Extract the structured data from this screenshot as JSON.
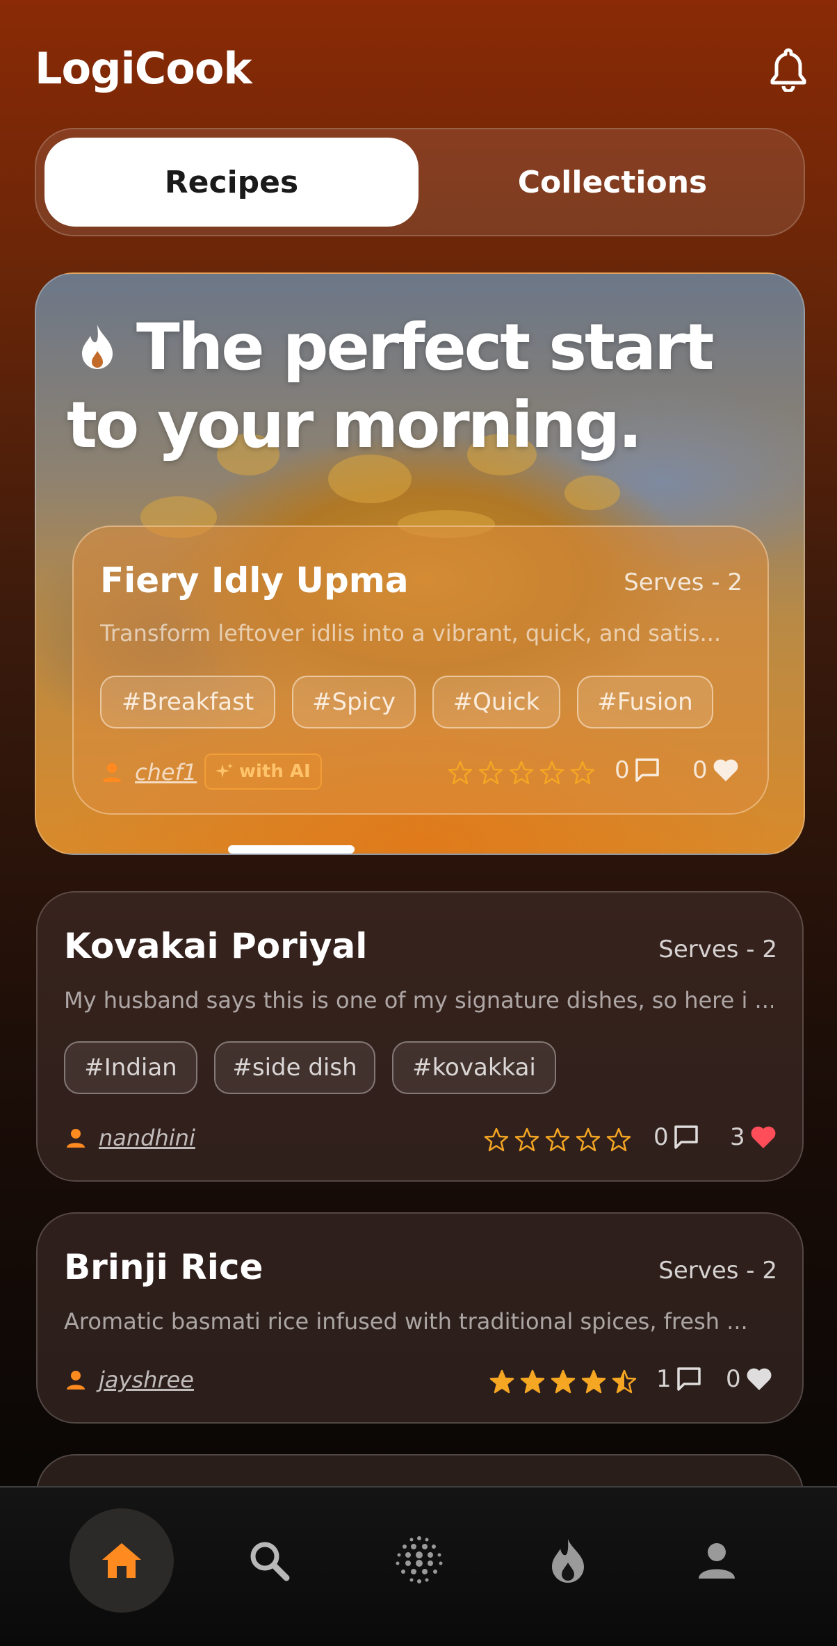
{
  "header": {
    "app_title": "LogiCook",
    "notification_icon": "bell-icon"
  },
  "tabs": [
    {
      "label": "Recipes",
      "active": true
    },
    {
      "label": "Collections",
      "active": false
    }
  ],
  "featured": {
    "headline": "The perfect start to your morning.",
    "headline_icon": "flame-icon",
    "recipe": {
      "title": "Fiery Idly Upma",
      "serves": "Serves - 2",
      "description": "Transform leftover idlis into a vibrant, quick, and satis...",
      "tags": [
        "#Breakfast",
        "#Spicy",
        "#Quick",
        "#Fusion"
      ],
      "author": "chef1",
      "ai_badge": "with AI",
      "rating": 0,
      "comments": "0",
      "likes": "0",
      "liked": false
    }
  },
  "recipes": [
    {
      "title": "Kovakai Poriyal",
      "serves": "Serves - 2",
      "description": "My husband says this is one of my signature dishes, so here i ...",
      "tags": [
        "#Indian",
        "#side dish",
        "#kovakkai"
      ],
      "author": "nandhini",
      "rating": 0,
      "comments": "0",
      "likes": "3",
      "liked": true
    },
    {
      "title": "Brinji Rice",
      "serves": "Serves - 2",
      "description": "Aromatic basmati rice infused with traditional spices, fresh ...",
      "tags": [],
      "author": "jayshree",
      "rating": 4.5,
      "comments": "1",
      "likes": "0",
      "liked": false
    }
  ],
  "bottom_nav": [
    {
      "icon": "home-icon",
      "active": true
    },
    {
      "icon": "search-icon",
      "active": false
    },
    {
      "icon": "dot-grid-icon",
      "active": false
    },
    {
      "icon": "flame-icon",
      "active": false
    },
    {
      "icon": "profile-icon",
      "active": false
    }
  ],
  "colors": {
    "accent": "#ff8a1f",
    "star": "#f5a623",
    "heart": "#ff4d5a",
    "background_top": "#8a2a06"
  }
}
